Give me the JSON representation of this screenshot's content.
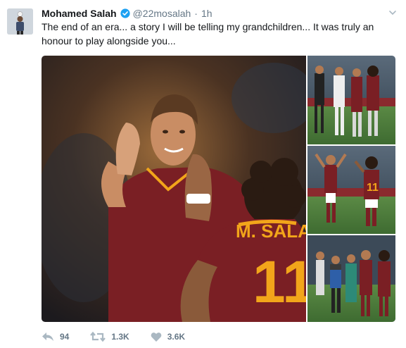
{
  "tweet": {
    "author_name": "Mohamed Salah",
    "handle": "@22mosalah",
    "separator": "·",
    "time": "1h",
    "text": "The end of an era... a story I will be telling my grandchildren... It was truly an honour to play alongside you...",
    "jersey_print": "M. SALA",
    "jersey_number": "11",
    "thumb_jersey_number": "11"
  },
  "actions": {
    "reply_count": "94",
    "retweet_count": "1.3K",
    "like_count": "3.6K"
  },
  "colors": {
    "accent": "#1da1f2",
    "text": "#14171a",
    "muted": "#657786",
    "roma_red": "#7a1f24",
    "roma_yellow": "#f2a51a"
  },
  "icons": [
    "verified-badge-icon",
    "caret-down-icon",
    "reply-icon",
    "retweet-icon",
    "heart-icon"
  ]
}
